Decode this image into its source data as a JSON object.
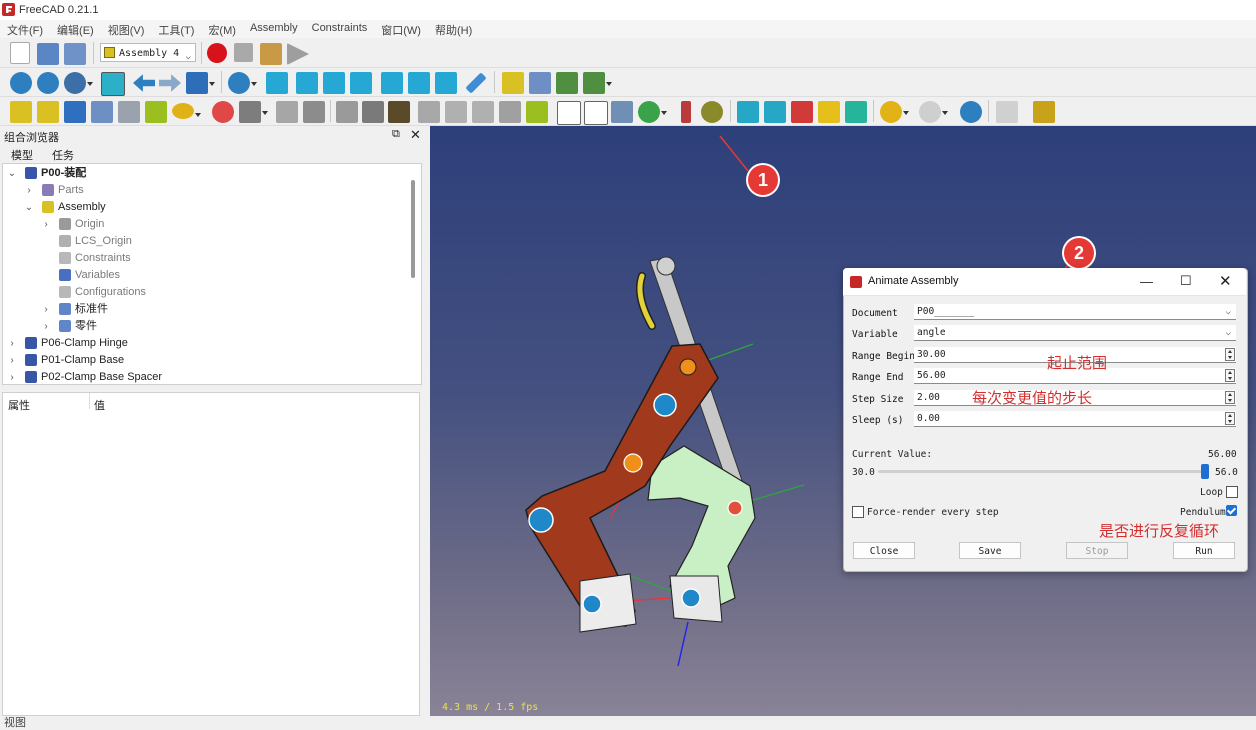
{
  "app": {
    "title": "FreeCAD 0.21.1"
  },
  "menu": [
    "文件(F)",
    "编辑(E)",
    "视图(V)",
    "工具(T)",
    "宏(M)",
    "Assembly",
    "Constraints",
    "窗口(W)",
    "帮助(H)"
  ],
  "toolbar": {
    "assembly_selector": "Assembly 4"
  },
  "left_panel": {
    "title": "组合浏览器",
    "tabs": [
      "模型",
      "任务"
    ],
    "tree": [
      {
        "label": "P00-装配",
        "bold": true
      },
      {
        "label": "Parts"
      },
      {
        "label": "Assembly"
      },
      {
        "label": "Origin"
      },
      {
        "label": "LCS_Origin"
      },
      {
        "label": "Constraints"
      },
      {
        "label": "Variables"
      },
      {
        "label": "Configurations"
      },
      {
        "label": "标准件"
      },
      {
        "label": "零件"
      },
      {
        "label": "P06-Clamp Hinge"
      },
      {
        "label": "P01-Clamp Base"
      },
      {
        "label": "P02-Clamp Base Spacer"
      }
    ],
    "properties": {
      "col_property": "属性",
      "col_value": "值"
    },
    "bottom_tab": "视图"
  },
  "viewport": {
    "fps": "4.3 ms / 1.5 fps"
  },
  "markers": [
    "1",
    "2"
  ],
  "dialog": {
    "title": "Animate Assembly",
    "fields": [
      {
        "label": "Document",
        "value": "P00_______"
      },
      {
        "label": "Variable",
        "value": "angle"
      },
      {
        "label": "Range Begin",
        "value": "30.00"
      },
      {
        "label": "Range End",
        "value": "56.00"
      },
      {
        "label": "Step Size",
        "value": "2.00"
      },
      {
        "label": "Sleep (s)",
        "value": "0.00"
      }
    ],
    "current_label": "Current Value:",
    "current_value": "56.00",
    "slider_min": "30.0",
    "slider_max": "56.0",
    "slider_value": 56,
    "loop_label": "Loop",
    "loop_checked": false,
    "force_render_label": "Force-render every step",
    "force_render_checked": false,
    "pendulum_label": "Pendulum",
    "pendulum_checked": true,
    "buttons": {
      "close": "Close",
      "save": "Save",
      "stop": "Stop",
      "run": "Run"
    }
  },
  "annotations": {
    "range": "起止范围",
    "step": "每次变更值的步长",
    "pendulum": "是否进行反复循环"
  },
  "colors": {
    "accent": "#1e6fd1",
    "annotation_red": "#d32f2f",
    "marker_red": "#e53935"
  }
}
